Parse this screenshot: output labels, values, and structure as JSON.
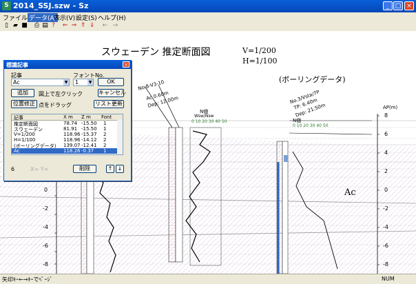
{
  "window": {
    "title": "2014_SSJ.szw - Sz"
  },
  "menu": {
    "file": "ファイル(F)",
    "data": "データ(A)",
    "view": "表示(V)",
    "settings": "設定(S)",
    "help": "ヘルプ(H)"
  },
  "drawing": {
    "title": "スウェーデン 推定断面図",
    "scale_v": "V=1/200",
    "scale_h": "H=1/100",
    "boring_note": "(ボーリングデータ)",
    "soil_label": "Ac",
    "ap_label": "AP(m)",
    "left_axis_ticks": [
      "0",
      "-2",
      "-4",
      "-6",
      "-8"
    ],
    "right_axis_ticks": [
      "8",
      "6",
      "4",
      "2",
      "0",
      "-2",
      "-4",
      "-6",
      "-8"
    ],
    "boring1": {
      "name": "No.8-V3-10",
      "line1": "Ac 0.60m",
      "line2": "Dep: 12.00m"
    },
    "boring2": {
      "name": "No.3/Vsta/7P",
      "line1": "TP: 6.40m",
      "line2": "Dep: 21.50m"
    },
    "nvalue1": {
      "label": "N値",
      "sub": "Wsw/Nsw",
      "ticks": "0 10 20 30 40 50"
    },
    "nvalue2": {
      "label": "N値",
      "ticks": "0 10 20 30 40 50"
    }
  },
  "dialog": {
    "title": "標識記事",
    "text_label": "記事",
    "font_label": "フォントNo.",
    "text_value": "Ac",
    "font_value": "1",
    "ok": "OK",
    "add": "追加",
    "move_hint": "図上で左クリック",
    "cancel": "キャンセル",
    "fix_position": "位置修正",
    "drag_hint": "点をドラッグ",
    "refresh": "リスト更新",
    "columns": [
      "記事",
      "X m",
      "Z m",
      "Font"
    ],
    "rows": [
      [
        "推定断面図",
        "78.74",
        "-15.50",
        "1"
      ],
      [
        "スウェーデン",
        "81.91",
        "-15.50",
        "1"
      ],
      [
        "V=1/200",
        "118.96",
        "-15.37",
        "2"
      ],
      [
        "H=1/100",
        "118.96",
        "-14.12",
        "2"
      ],
      [
        "(ボーリングデータ)",
        "139.07",
        "-12.41",
        "2"
      ],
      [
        "Ac",
        "118.26",
        "-0.37",
        "1"
      ]
    ],
    "count": "6",
    "coord_placeholder": "X=  Y=",
    "delete": "削除",
    "up": "↑",
    "down": "↓"
  },
  "status": {
    "text": "矢印ｷｰ←→ｷｰでﾍﾟｰｼﾞ",
    "num": "NUM"
  }
}
